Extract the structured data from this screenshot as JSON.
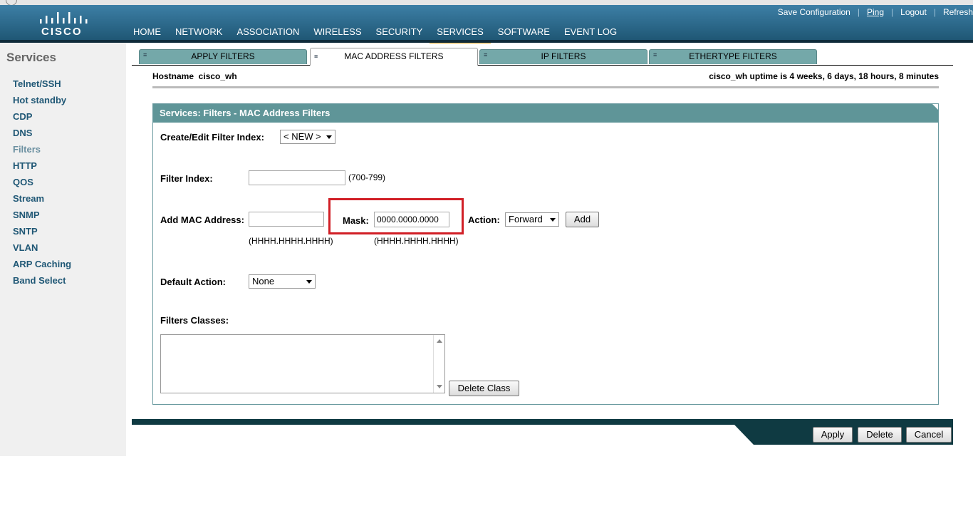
{
  "brand": {
    "logo_text": "CISCO"
  },
  "toplinks": [
    "Save Configuration",
    "Ping",
    "Logout",
    "Refresh"
  ],
  "nav": [
    "HOME",
    "NETWORK",
    "ASSOCIATION",
    "WIRELESS",
    "SECURITY",
    "SERVICES",
    "SOFTWARE",
    "EVENT LOG"
  ],
  "nav_active": "SERVICES",
  "sidebar": {
    "title": "Services",
    "items": [
      "Telnet/SSH",
      "Hot standby",
      "CDP",
      "DNS",
      "Filters",
      "HTTP",
      "QOS",
      "Stream",
      "SNMP",
      "SNTP",
      "VLAN",
      "ARP Caching",
      "Band Select"
    ],
    "active": "Filters"
  },
  "tabs": [
    "APPLY FILTERS",
    "MAC ADDRESS FILTERS",
    "IP FILTERS",
    "ETHERTYPE FILTERS"
  ],
  "tab_active": "MAC ADDRESS FILTERS",
  "hostname_label": "Hostname  cisco_wh",
  "uptime": "cisco_wh uptime is 4 weeks, 6 days, 18 hours, 8 minutes",
  "panel": {
    "title": "Services: Filters - MAC Address Filters",
    "create_edit_label": "Create/Edit Filter Index:",
    "create_edit_value": "< NEW >",
    "filter_index_label": "Filter Index:",
    "filter_index_value": "",
    "filter_index_range": "(700-799)",
    "add_mac_label": "Add MAC Address:",
    "add_mac_value": "",
    "add_mac_hint": "(HHHH.HHHH.HHHH)",
    "mask_label": "Mask:",
    "mask_value": "0000.0000.0000",
    "mask_hint": "(HHHH.HHHH.HHHH)",
    "action_label": "Action:",
    "action_value": "Forward",
    "add_button": "Add",
    "default_action_label": "Default Action:",
    "default_action_value": "None",
    "filter_classes_label": "Filters Classes:",
    "delete_class_button": "Delete Class"
  },
  "footer": {
    "apply": "Apply",
    "delete": "Delete",
    "cancel": "Cancel"
  },
  "colors": {
    "header": "#2e6b8f",
    "accent": "#f5a623",
    "tab": "#74a8a9",
    "panel_head": "#5f9598",
    "highlight": "#d11f26"
  }
}
